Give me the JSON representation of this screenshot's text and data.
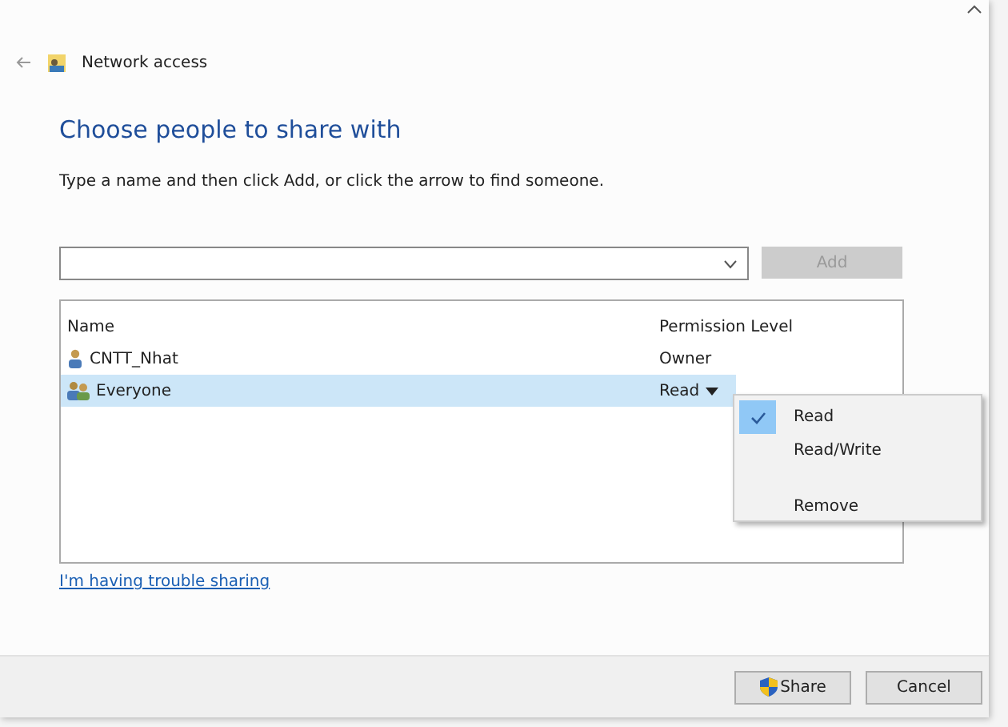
{
  "window": {
    "title": "Network access"
  },
  "heading": "Choose people to share with",
  "instruction": "Type a name and then click Add, or click the arrow to find someone.",
  "add_button": {
    "label": "Add",
    "disabled": true
  },
  "table": {
    "columns": [
      "Name",
      "Permission Level"
    ],
    "rows": [
      {
        "kind": "user",
        "name": "CNTT_Nhat",
        "permission": "Owner",
        "dropdown": false,
        "selected": false
      },
      {
        "kind": "group",
        "name": "Everyone",
        "permission": "Read",
        "dropdown": true,
        "selected": true
      }
    ]
  },
  "permission_menu": {
    "items": [
      {
        "kind": "option",
        "label": "Read",
        "checked": true
      },
      {
        "kind": "option",
        "label": "Read/Write",
        "checked": false
      },
      {
        "kind": "separator"
      },
      {
        "kind": "option",
        "label": "Remove",
        "checked": false
      }
    ]
  },
  "help_link": "I'm having trouble sharing",
  "buttons": [
    {
      "kind": "shield",
      "label": "Share"
    },
    {
      "kind": "plain",
      "label": "Cancel"
    }
  ]
}
